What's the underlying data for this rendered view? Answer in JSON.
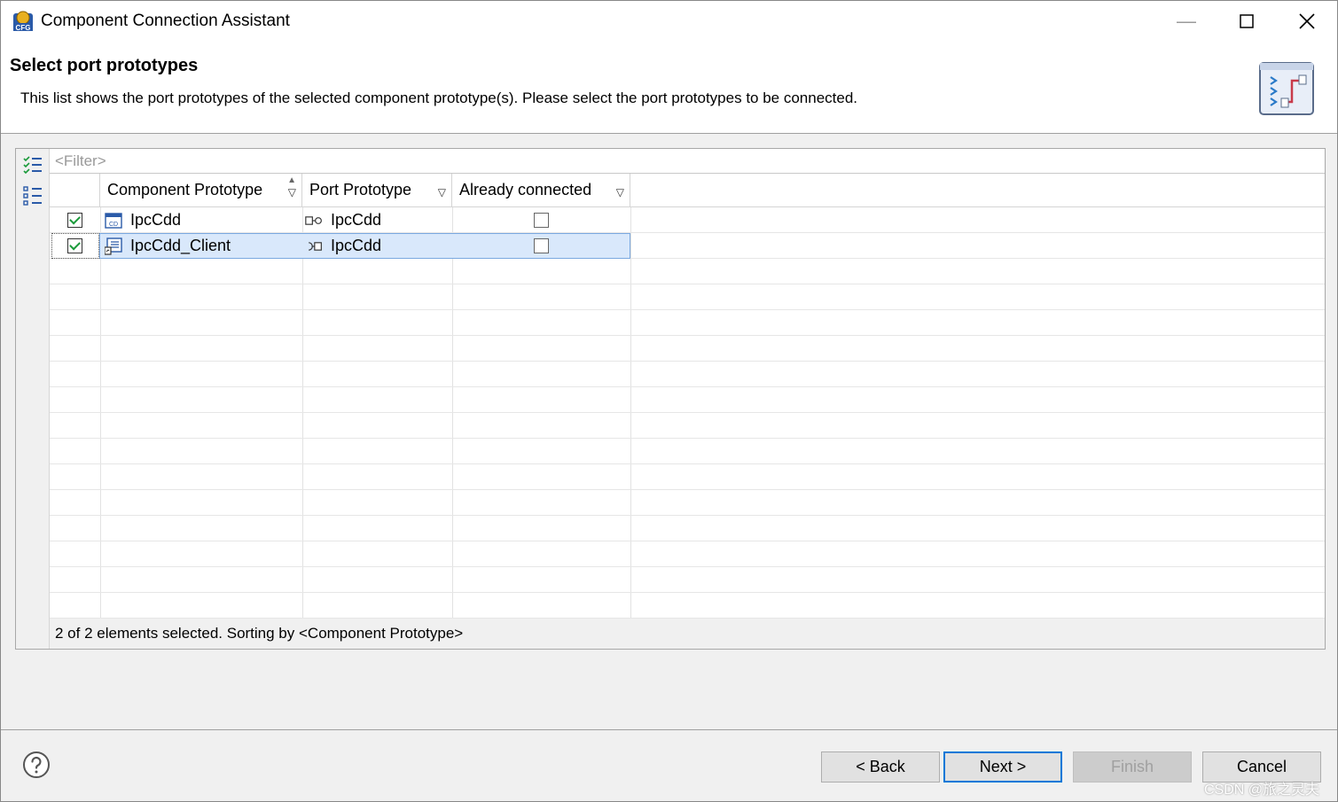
{
  "window": {
    "title": "Component Connection Assistant",
    "min_glyph": "—",
    "max_glyph": "☐",
    "close_glyph": "✕"
  },
  "header": {
    "title": "Select port prototypes",
    "description": "This list shows the port prototypes of the selected component prototype(s). Please select the port prototypes to be connected."
  },
  "filter": {
    "placeholder": "<Filter>"
  },
  "table": {
    "columns": [
      {
        "label": "Component Prototype",
        "sorted": "ascending"
      },
      {
        "label": "Port Prototype"
      },
      {
        "label": "Already connected"
      }
    ],
    "rows": [
      {
        "checked": true,
        "component": "IpcCdd",
        "component_icon": "component-icon",
        "port": "IpcCdd",
        "port_icon": "provide-port-icon",
        "already_connected": false,
        "selected": false
      },
      {
        "checked": true,
        "component": "IpcCdd_Client",
        "component_icon": "client-component-icon",
        "port": "IpcCdd",
        "port_icon": "require-port-icon",
        "already_connected": false,
        "selected": true
      }
    ]
  },
  "status": "2 of 2 elements selected. Sorting by <Component Prototype>",
  "buttons": {
    "back": "< Back",
    "next": "Next >",
    "finish": "Finish",
    "cancel": "Cancel"
  },
  "watermark": "CSDN @旅之灵夫",
  "colors": {
    "accent": "#0078d7",
    "selection": "#d9e8fb",
    "check": "#1a9a3a"
  }
}
